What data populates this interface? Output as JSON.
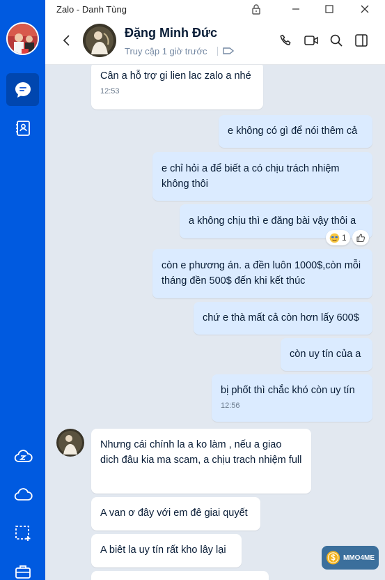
{
  "window": {
    "title": "Zalo - Danh Tùng"
  },
  "header": {
    "contact_name": "Đặng Minh Đức",
    "status": "Truy cập 1 giờ trước"
  },
  "messages": [
    {
      "text": "Cân a hỗ trợ gi lien lac zalo a nhé",
      "time": "12:53"
    },
    {
      "text": "e không có gì để nói thêm cả"
    },
    {
      "text": "e chỉ hỏi a để biết a có chịu trách nhiệm không thôi"
    },
    {
      "text": "a không chịu thì e đăng bài vậy thôi a",
      "reaction_count": "1"
    },
    {
      "text": "còn e phương án. a đền luôn 1000$,còn mỗi tháng đền 500$ đến khi kết thúc"
    },
    {
      "text": "chứ e thà mất cả còn hơn lấy 600$"
    },
    {
      "text": "còn uy tín của a"
    },
    {
      "text": "bị phốt thì chắc khó còn uy tín",
      "time": "12:56"
    },
    {
      "text": "Nhưng cái chính la a ko làm  , nếu a giao dich đâu kia ma scam, a chịu trach nhiệm full"
    },
    {
      "text": "A van ơ đây với em đê giai quyết"
    },
    {
      "text": "A biêt la uy tín rất kho lây lại"
    }
  ],
  "watermark": {
    "text": "MMO4ME"
  },
  "colors": {
    "sidebar": "#005ae0",
    "chat_bg": "#e2e8f0",
    "out_bubble": "#dbebff",
    "in_bubble": "#ffffff"
  }
}
